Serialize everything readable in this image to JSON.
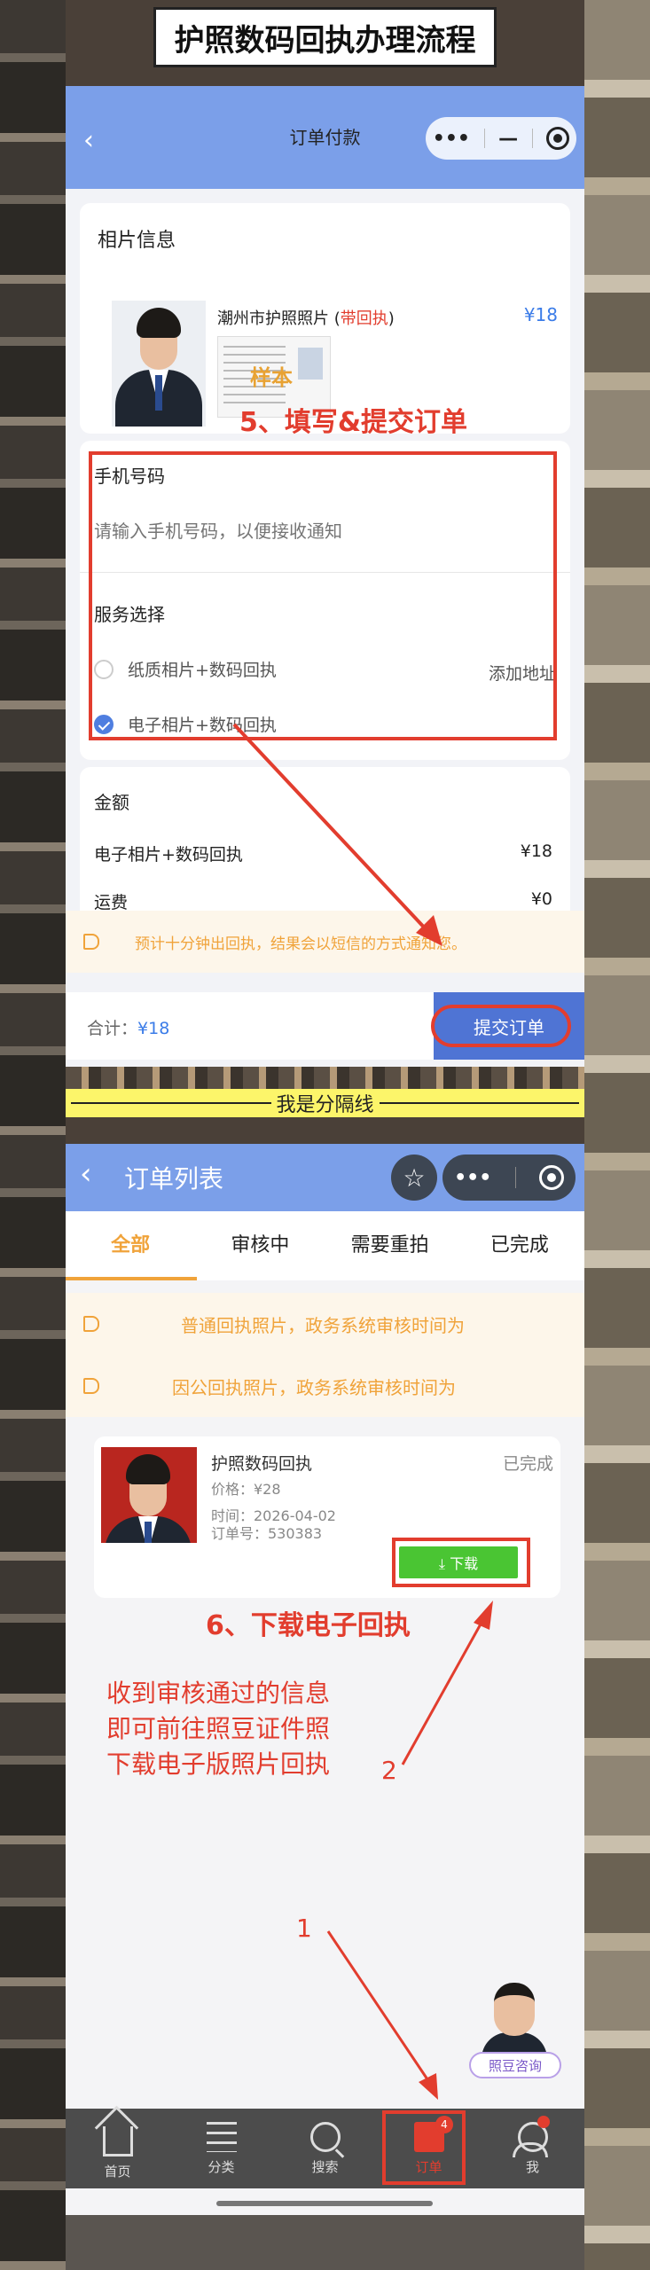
{
  "banner_title": "护照数码回执办理流程",
  "page1": {
    "nav_title": "订单付款",
    "photo_section_title": "相片信息",
    "product_name_prefix": "潮州市护照照片 (",
    "product_name_tag": "带回执",
    "product_name_suffix": ")",
    "product_price": "¥18",
    "sample_stamp": "样本",
    "annotation_step5": "5、填写&提交订单",
    "phone_label": "手机号码",
    "phone_placeholder": "请输入手机号码，以便接收通知",
    "service_label": "服务选择",
    "option_paper": "纸质相片+数码回执",
    "add_address": "添加地址",
    "option_electronic": "电子相片+数码回执",
    "amount_title": "金额",
    "line_item_label": "电子相片+数码回执",
    "line_item_value": "¥18",
    "shipping_label": "运费",
    "shipping_value": "¥0",
    "notice": "预计十分钟出回执，结果会以短信的方式通知您。",
    "total_label": "合计：",
    "total_value": "¥18",
    "submit_label": "提交订单"
  },
  "separator_text": "我是分隔线",
  "page2": {
    "nav_title": "订单列表",
    "tabs": [
      "全部",
      "审核中",
      "需要重拍",
      "已完成"
    ],
    "notice_a": "普通回执照片，政务系统审核时间为",
    "notice_b": "因公回执照片，政务系统审核时间为",
    "order": {
      "name": "护照数码回执",
      "status": "已完成",
      "price": "价格：¥28",
      "time": "时间：2026-04-02",
      "order_no": "订单号：530383",
      "download_label": "⤓ 下载"
    },
    "annotation_step6": "6、下载电子回执",
    "note_lines": [
      "收到审核通过的信息",
      "即可前往照豆证件照",
      "下载电子版照片回执"
    ],
    "marker_1": "1",
    "marker_2": "2",
    "consult_label": "照豆咨询",
    "tabbar": [
      {
        "label": "首页",
        "icon": "home-icon"
      },
      {
        "label": "分类",
        "icon": "category-icon"
      },
      {
        "label": "搜索",
        "icon": "search-icon"
      },
      {
        "label": "订单",
        "icon": "order-icon",
        "badge": "4"
      },
      {
        "label": "我",
        "icon": "user-icon"
      }
    ]
  },
  "colors": {
    "nav_blue": "#7b9fe9",
    "accent_red": "#e23d2e",
    "price_blue": "#3b7ce8",
    "tab_orange": "#f0a33a",
    "download_green": "#4ac533",
    "separator_yellow": "#fcf56a"
  }
}
